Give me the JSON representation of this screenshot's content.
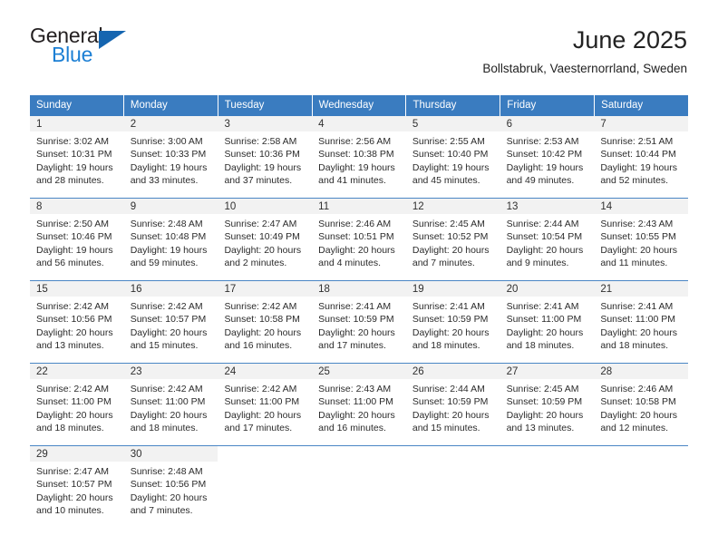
{
  "brand": {
    "name_top": "General",
    "name_bottom": "Blue",
    "color_top": "#231f20",
    "color_bottom": "#1c7fd4",
    "triangle_color": "#1565b0"
  },
  "header": {
    "title": "June 2025",
    "subtitle": "Bollstabruk, Vaesternorrland, Sweden"
  },
  "colors": {
    "header_row_bg": "#3a7cc0",
    "header_row_text": "#ffffff",
    "day_number_band": "#f2f2f2",
    "week_divider": "#4a86c5",
    "body_text": "#2b2b2b"
  },
  "weekdays": [
    "Sunday",
    "Monday",
    "Tuesday",
    "Wednesday",
    "Thursday",
    "Friday",
    "Saturday"
  ],
  "labels": {
    "sunrise_prefix": "Sunrise:",
    "sunset_prefix": "Sunset:",
    "daylight_prefix": "Daylight:"
  },
  "weeks": [
    [
      {
        "day": "1",
        "sunrise": "Sunrise: 3:02 AM",
        "sunset": "Sunset: 10:31 PM",
        "daylight": "Daylight: 19 hours and 28 minutes."
      },
      {
        "day": "2",
        "sunrise": "Sunrise: 3:00 AM",
        "sunset": "Sunset: 10:33 PM",
        "daylight": "Daylight: 19 hours and 33 minutes."
      },
      {
        "day": "3",
        "sunrise": "Sunrise: 2:58 AM",
        "sunset": "Sunset: 10:36 PM",
        "daylight": "Daylight: 19 hours and 37 minutes."
      },
      {
        "day": "4",
        "sunrise": "Sunrise: 2:56 AM",
        "sunset": "Sunset: 10:38 PM",
        "daylight": "Daylight: 19 hours and 41 minutes."
      },
      {
        "day": "5",
        "sunrise": "Sunrise: 2:55 AM",
        "sunset": "Sunset: 10:40 PM",
        "daylight": "Daylight: 19 hours and 45 minutes."
      },
      {
        "day": "6",
        "sunrise": "Sunrise: 2:53 AM",
        "sunset": "Sunset: 10:42 PM",
        "daylight": "Daylight: 19 hours and 49 minutes."
      },
      {
        "day": "7",
        "sunrise": "Sunrise: 2:51 AM",
        "sunset": "Sunset: 10:44 PM",
        "daylight": "Daylight: 19 hours and 52 minutes."
      }
    ],
    [
      {
        "day": "8",
        "sunrise": "Sunrise: 2:50 AM",
        "sunset": "Sunset: 10:46 PM",
        "daylight": "Daylight: 19 hours and 56 minutes."
      },
      {
        "day": "9",
        "sunrise": "Sunrise: 2:48 AM",
        "sunset": "Sunset: 10:48 PM",
        "daylight": "Daylight: 19 hours and 59 minutes."
      },
      {
        "day": "10",
        "sunrise": "Sunrise: 2:47 AM",
        "sunset": "Sunset: 10:49 PM",
        "daylight": "Daylight: 20 hours and 2 minutes."
      },
      {
        "day": "11",
        "sunrise": "Sunrise: 2:46 AM",
        "sunset": "Sunset: 10:51 PM",
        "daylight": "Daylight: 20 hours and 4 minutes."
      },
      {
        "day": "12",
        "sunrise": "Sunrise: 2:45 AM",
        "sunset": "Sunset: 10:52 PM",
        "daylight": "Daylight: 20 hours and 7 minutes."
      },
      {
        "day": "13",
        "sunrise": "Sunrise: 2:44 AM",
        "sunset": "Sunset: 10:54 PM",
        "daylight": "Daylight: 20 hours and 9 minutes."
      },
      {
        "day": "14",
        "sunrise": "Sunrise: 2:43 AM",
        "sunset": "Sunset: 10:55 PM",
        "daylight": "Daylight: 20 hours and 11 minutes."
      }
    ],
    [
      {
        "day": "15",
        "sunrise": "Sunrise: 2:42 AM",
        "sunset": "Sunset: 10:56 PM",
        "daylight": "Daylight: 20 hours and 13 minutes."
      },
      {
        "day": "16",
        "sunrise": "Sunrise: 2:42 AM",
        "sunset": "Sunset: 10:57 PM",
        "daylight": "Daylight: 20 hours and 15 minutes."
      },
      {
        "day": "17",
        "sunrise": "Sunrise: 2:42 AM",
        "sunset": "Sunset: 10:58 PM",
        "daylight": "Daylight: 20 hours and 16 minutes."
      },
      {
        "day": "18",
        "sunrise": "Sunrise: 2:41 AM",
        "sunset": "Sunset: 10:59 PM",
        "daylight": "Daylight: 20 hours and 17 minutes."
      },
      {
        "day": "19",
        "sunrise": "Sunrise: 2:41 AM",
        "sunset": "Sunset: 10:59 PM",
        "daylight": "Daylight: 20 hours and 18 minutes."
      },
      {
        "day": "20",
        "sunrise": "Sunrise: 2:41 AM",
        "sunset": "Sunset: 11:00 PM",
        "daylight": "Daylight: 20 hours and 18 minutes."
      },
      {
        "day": "21",
        "sunrise": "Sunrise: 2:41 AM",
        "sunset": "Sunset: 11:00 PM",
        "daylight": "Daylight: 20 hours and 18 minutes."
      }
    ],
    [
      {
        "day": "22",
        "sunrise": "Sunrise: 2:42 AM",
        "sunset": "Sunset: 11:00 PM",
        "daylight": "Daylight: 20 hours and 18 minutes."
      },
      {
        "day": "23",
        "sunrise": "Sunrise: 2:42 AM",
        "sunset": "Sunset: 11:00 PM",
        "daylight": "Daylight: 20 hours and 18 minutes."
      },
      {
        "day": "24",
        "sunrise": "Sunrise: 2:42 AM",
        "sunset": "Sunset: 11:00 PM",
        "daylight": "Daylight: 20 hours and 17 minutes."
      },
      {
        "day": "25",
        "sunrise": "Sunrise: 2:43 AM",
        "sunset": "Sunset: 11:00 PM",
        "daylight": "Daylight: 20 hours and 16 minutes."
      },
      {
        "day": "26",
        "sunrise": "Sunrise: 2:44 AM",
        "sunset": "Sunset: 10:59 PM",
        "daylight": "Daylight: 20 hours and 15 minutes."
      },
      {
        "day": "27",
        "sunrise": "Sunrise: 2:45 AM",
        "sunset": "Sunset: 10:59 PM",
        "daylight": "Daylight: 20 hours and 13 minutes."
      },
      {
        "day": "28",
        "sunrise": "Sunrise: 2:46 AM",
        "sunset": "Sunset: 10:58 PM",
        "daylight": "Daylight: 20 hours and 12 minutes."
      }
    ],
    [
      {
        "day": "29",
        "sunrise": "Sunrise: 2:47 AM",
        "sunset": "Sunset: 10:57 PM",
        "daylight": "Daylight: 20 hours and 10 minutes."
      },
      {
        "day": "30",
        "sunrise": "Sunrise: 2:48 AM",
        "sunset": "Sunset: 10:56 PM",
        "daylight": "Daylight: 20 hours and 7 minutes."
      },
      {
        "day": "",
        "sunrise": "",
        "sunset": "",
        "daylight": ""
      },
      {
        "day": "",
        "sunrise": "",
        "sunset": "",
        "daylight": ""
      },
      {
        "day": "",
        "sunrise": "",
        "sunset": "",
        "daylight": ""
      },
      {
        "day": "",
        "sunrise": "",
        "sunset": "",
        "daylight": ""
      },
      {
        "day": "",
        "sunrise": "",
        "sunset": "",
        "daylight": ""
      }
    ]
  ]
}
